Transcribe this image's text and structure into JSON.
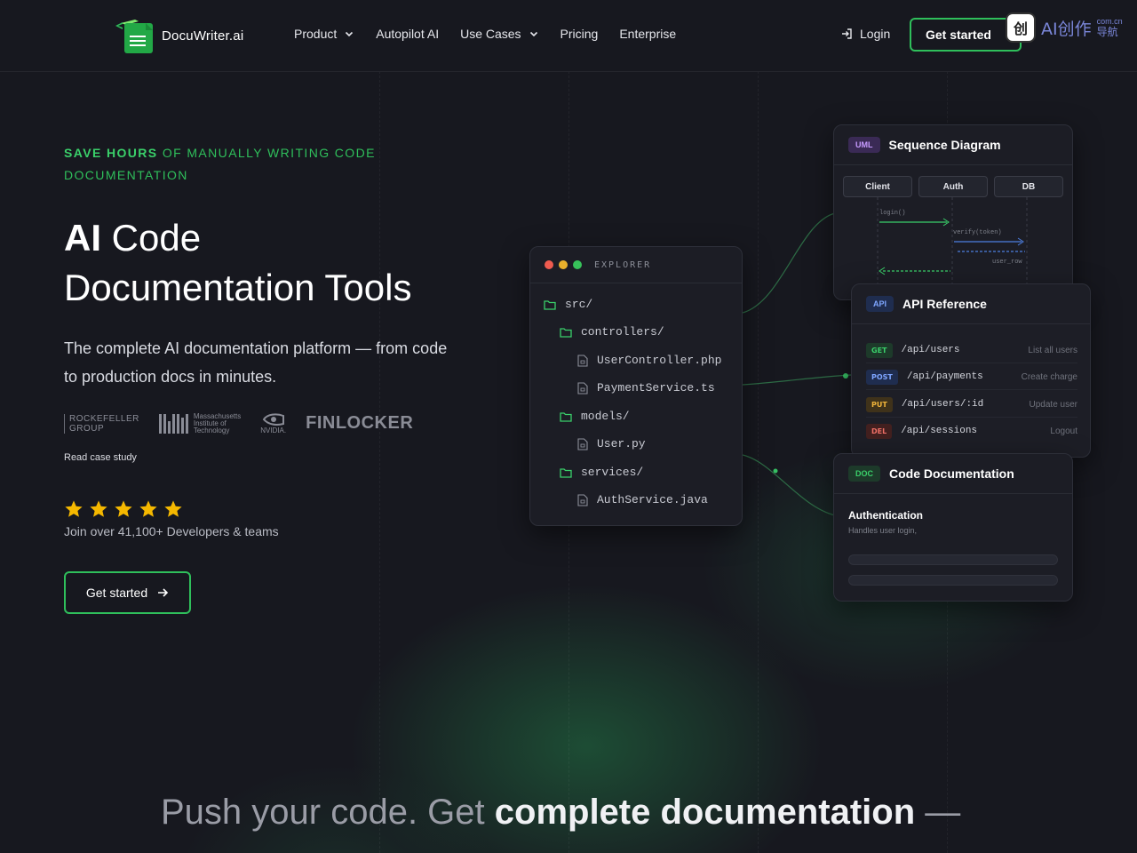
{
  "brand": {
    "name": "DocuWriter.ai",
    "accent": "#2fbf5b"
  },
  "nav": {
    "items": [
      {
        "label": "Product",
        "dropdown": true
      },
      {
        "label": "Autopilot AI",
        "dropdown": false
      },
      {
        "label": "Use Cases",
        "dropdown": true
      },
      {
        "label": "Pricing",
        "dropdown": false
      },
      {
        "label": "Enterprise",
        "dropdown": false
      }
    ],
    "login": "Login",
    "cta": "Get started"
  },
  "watermark": {
    "badge": "创",
    "text": "AI创作",
    "small_top": "com.cn",
    "small_bottom": "导航"
  },
  "hero": {
    "eyebrow_strong": "SAVE HOURS",
    "eyebrow_rest": " OF MANUALLY WRITING CODE DOCUMENTATION",
    "title_bold": "AI",
    "title_rest": " Code",
    "title_line2": "Documentation Tools",
    "subtitle": "The complete AI documentation platform — from code to production docs in minutes.",
    "logos": {
      "rockefeller_1": "ROCKEFELLER",
      "rockefeller_2": "GROUP",
      "mit_1": "Massachusetts",
      "mit_2": "Institute of",
      "mit_3": "Technology",
      "nvidia": "NVIDIA.",
      "finlocker": "FINLOCKER"
    },
    "case_study": "Read case study",
    "rating_stars": 5,
    "social_proof": "Join over 41,100+ Developers & teams",
    "cta": "Get started"
  },
  "explorer": {
    "title": "EXPLORER",
    "items": [
      "src/",
      "controllers/",
      "UserController.php",
      "PaymentService.ts",
      "models/",
      "User.py",
      "services/",
      "AuthService.java"
    ]
  },
  "sequence": {
    "tag": "UML",
    "title": "Sequence Diagram",
    "actors": [
      "Client",
      "Auth",
      "DB"
    ],
    "messages": [
      "login()",
      "verify(token)",
      "user_row"
    ]
  },
  "api_reference": {
    "tag": "API",
    "title": "API Reference",
    "endpoints": [
      {
        "method": "GET",
        "path": "/api/users",
        "desc": "List all users"
      },
      {
        "method": "POST",
        "path": "/api/payments",
        "desc": "Create charge"
      },
      {
        "method": "PUT",
        "path": "/api/users/:id",
        "desc": "Update user"
      },
      {
        "method": "DEL",
        "path": "/api/sessions",
        "desc": "Logout"
      }
    ]
  },
  "code_doc": {
    "tag": "DOC",
    "title": "Code Documentation",
    "heading": "Authentication",
    "text": "Handles user login,"
  },
  "bottom": {
    "light": "Push your code. Get ",
    "bold": "complete documentation",
    "tail": " —"
  }
}
